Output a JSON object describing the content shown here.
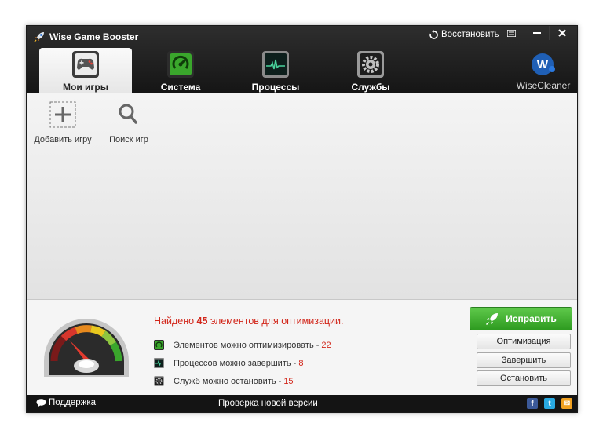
{
  "window": {
    "title": "Wise Game Booster",
    "restore_label": "Восстановить"
  },
  "tabs": [
    {
      "label": "Мои игры",
      "icon": "gamepad-icon",
      "active": true
    },
    {
      "label": "Система",
      "icon": "system-optimize-icon",
      "active": false
    },
    {
      "label": "Процессы",
      "icon": "process-monitor-icon",
      "active": false
    },
    {
      "label": "Службы",
      "icon": "services-gear-icon",
      "active": false
    }
  ],
  "brand": {
    "label": "WiseCleaner",
    "logo_letter": "W"
  },
  "toolbar": {
    "add_game": "Добавить игру",
    "search_games": "Поиск игр"
  },
  "summary": {
    "prefix": "Найдено",
    "count": "45",
    "suffix": "элементов для оптимизации."
  },
  "items": [
    {
      "label": "Элементов можно оптимизировать -",
      "count": "22",
      "icon": "optimize-icon"
    },
    {
      "label": "Процессов можно завершить -",
      "count": "8",
      "icon": "process-icon"
    },
    {
      "label": "Служб можно остановить -",
      "count": "15",
      "icon": "service-icon"
    }
  ],
  "actions": {
    "fix": "Исправить",
    "optimize": "Оптимизация",
    "terminate": "Завершить",
    "stop": "Остановить"
  },
  "statusbar": {
    "support": "Поддержка",
    "update": "Проверка новой версии",
    "social": [
      "f",
      "t",
      "✉"
    ]
  },
  "colors": {
    "accent_red": "#d2261a",
    "fix_green": "#3aab2a",
    "titlebar": "#1e1e1e"
  }
}
